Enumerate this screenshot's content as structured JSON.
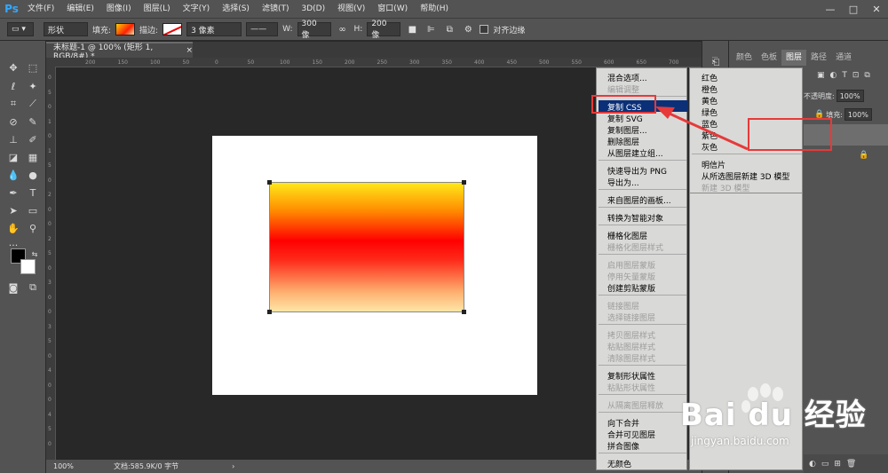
{
  "menubar": {
    "logo": "Ps",
    "items": [
      "文件(F)",
      "编辑(E)",
      "图像(I)",
      "图层(L)",
      "文字(Y)",
      "选择(S)",
      "滤镜(T)",
      "3D(D)",
      "视图(V)",
      "窗口(W)",
      "帮助(H)"
    ],
    "window_controls": [
      "—",
      "□",
      "✕"
    ]
  },
  "optionsbar": {
    "mode": "形状",
    "fill_label": "填充:",
    "stroke_label": "描边:",
    "stroke_width": "3 像素",
    "w_label": "W:",
    "w_value": "300 像",
    "h_label": "H:",
    "h_value": "200 像",
    "align_edges": "对齐边缘"
  },
  "document": {
    "tab_title": "未标题-1 @ 100% (矩形 1, RGB/8#) *",
    "tab_close": "×",
    "zoom": "100%",
    "doc_info": "文档:585.9K/0 字节",
    "status_arrow": "›"
  },
  "ruler_top_labels": [
    "200",
    "150",
    "100",
    "50",
    "0",
    "50",
    "100",
    "150",
    "200",
    "250",
    "300",
    "350",
    "400",
    "450",
    "500",
    "550",
    "600",
    "650",
    "700"
  ],
  "ruler_left_labels": [
    "0",
    "5",
    "0",
    "1",
    "0",
    "1",
    "5",
    "0",
    "2",
    "0",
    "0",
    "2",
    "5",
    "0",
    "3",
    "0",
    "0",
    "3",
    "5",
    "0",
    "4",
    "0",
    "0",
    "4",
    "5",
    "0"
  ],
  "panels": {
    "tabs": [
      "颜色",
      "色板",
      "图层",
      "路径",
      "通道"
    ],
    "active_tab": "图层",
    "opacity_label": "不透明度:",
    "opacity_value": "100%",
    "fill_label": "填充:",
    "fill_value": "100%"
  },
  "context_menu": {
    "items": [
      {
        "label": "混合选项...",
        "disabled": false
      },
      {
        "label": "编辑调整",
        "disabled": true
      },
      {
        "label": "复制 CSS",
        "disabled": false,
        "highlighted": true
      },
      {
        "label": "复制 SVG",
        "disabled": false
      },
      {
        "label": "复制图层...",
        "disabled": false
      },
      {
        "label": "删除图层",
        "disabled": false
      },
      {
        "label": "从图层建立组...",
        "disabled": false
      },
      {
        "label": "快速导出为 PNG",
        "disabled": false
      },
      {
        "label": "导出为...",
        "disabled": false
      },
      {
        "label": "来自图层的画板...",
        "disabled": false
      },
      {
        "label": "转换为智能对象",
        "disabled": false
      },
      {
        "label": "栅格化图层",
        "disabled": false
      },
      {
        "label": "栅格化图层样式",
        "disabled": true
      },
      {
        "label": "启用图层蒙版",
        "disabled": true
      },
      {
        "label": "停用矢量蒙版",
        "disabled": true
      },
      {
        "label": "创建剪贴蒙版",
        "disabled": false
      },
      {
        "label": "链接图层",
        "disabled": true
      },
      {
        "label": "选择链接图层",
        "disabled": true
      },
      {
        "label": "拷贝图层样式",
        "disabled": true
      },
      {
        "label": "粘贴图层样式",
        "disabled": true
      },
      {
        "label": "清除图层样式",
        "disabled": true
      },
      {
        "label": "复制形状属性",
        "disabled": false
      },
      {
        "label": "粘贴形状属性",
        "disabled": true
      },
      {
        "label": "从隔离图层释放",
        "disabled": true
      },
      {
        "label": "向下合并",
        "disabled": false
      },
      {
        "label": "合并可见图层",
        "disabled": false
      },
      {
        "label": "拼合图像",
        "disabled": false
      },
      {
        "label": "无颜色",
        "disabled": false
      }
    ]
  },
  "sub_menu": {
    "items": [
      {
        "label": "红色",
        "disabled": false
      },
      {
        "label": "橙色",
        "disabled": false
      },
      {
        "label": "黄色",
        "disabled": false
      },
      {
        "label": "绿色",
        "disabled": false
      },
      {
        "label": "蓝色",
        "disabled": false
      },
      {
        "label": "紫色",
        "disabled": false
      },
      {
        "label": "灰色",
        "disabled": false
      },
      {
        "label": "明信片",
        "disabled": false
      },
      {
        "label": "从所选图层新建 3D 模型",
        "disabled": false
      },
      {
        "label": "新建 3D 模型",
        "disabled": true
      }
    ]
  },
  "watermark": {
    "brand": "Bai du 经验",
    "url": "jingyan.baidu.com"
  },
  "colors": {
    "annotation_red": "#e63a3a",
    "menu_highlight": "#0b3078"
  }
}
